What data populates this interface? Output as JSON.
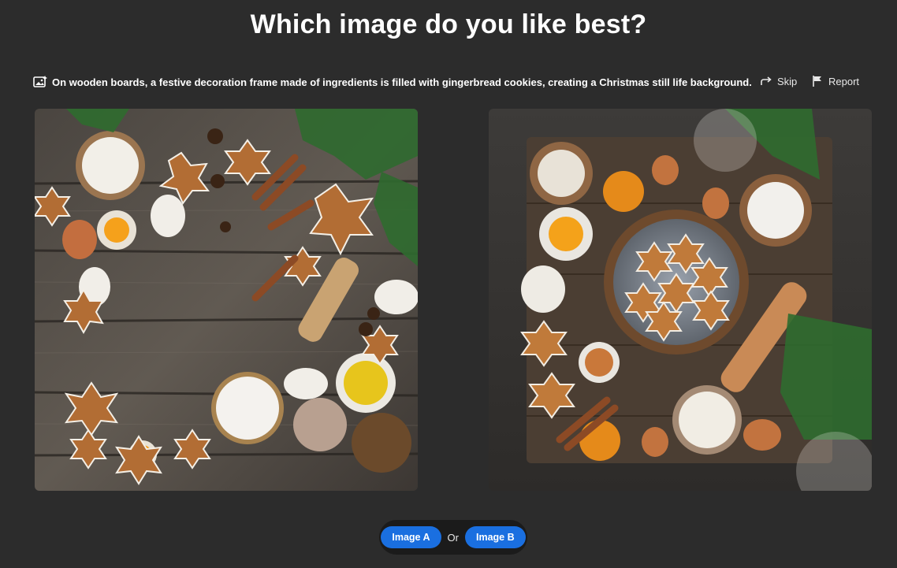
{
  "header": {
    "title": "Which image do you like best?"
  },
  "prompt": {
    "icon": "ai-image-icon",
    "text": "On wooden boards, a festive decoration frame made of ingredients is filled with gingerbread cookies, creating a Christmas still life background."
  },
  "actions": {
    "skip_label": "Skip",
    "skip_icon": "skip-arrow-icon",
    "report_label": "Report",
    "report_icon": "flag-icon"
  },
  "images": [
    {
      "id": "a",
      "alt": "Image A"
    },
    {
      "id": "b",
      "alt": "Image B"
    }
  ],
  "choice": {
    "option_a_label": "Image A",
    "separator": "Or",
    "option_b_label": "Image B"
  },
  "colors": {
    "background": "#2c2c2c",
    "accent": "#1a6fe0",
    "choice_bar": "#1b1b1b"
  }
}
